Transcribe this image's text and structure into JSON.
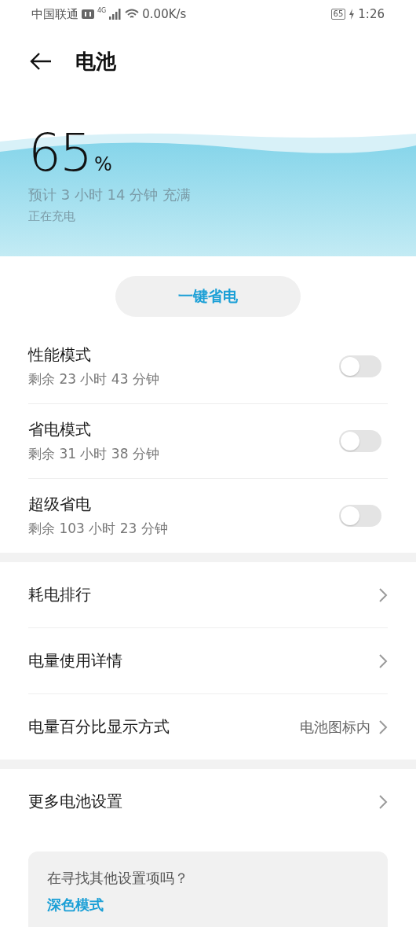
{
  "status_bar": {
    "carrier": "中国联通",
    "network": "4G",
    "speed": "0.00K/s",
    "battery": "65",
    "charging": true,
    "time": "1:26"
  },
  "header": {
    "title": "电池"
  },
  "battery": {
    "percent": "65",
    "unit": "%",
    "estimate": "预计 3 小时 14 分钟 充满",
    "state": "正在充电"
  },
  "save_button": {
    "label": "一键省电"
  },
  "modes": [
    {
      "title": "性能模式",
      "subtitle": "剩余 23 小时 43 分钟",
      "on": false
    },
    {
      "title": "省电模式",
      "subtitle": "剩余 31 小时 38 分钟",
      "on": false
    },
    {
      "title": "超级省电",
      "subtitle": "剩余 103 小时 23 分钟",
      "on": false
    }
  ],
  "menu": [
    {
      "label": "耗电排行"
    },
    {
      "label": "电量使用详情"
    },
    {
      "label": "电量百分比显示方式",
      "value": "电池图标内"
    }
  ],
  "more": [
    {
      "label": "更多电池设置"
    }
  ],
  "tip_card": {
    "question": "在寻找其他设置项吗？",
    "link": "深色模式"
  }
}
